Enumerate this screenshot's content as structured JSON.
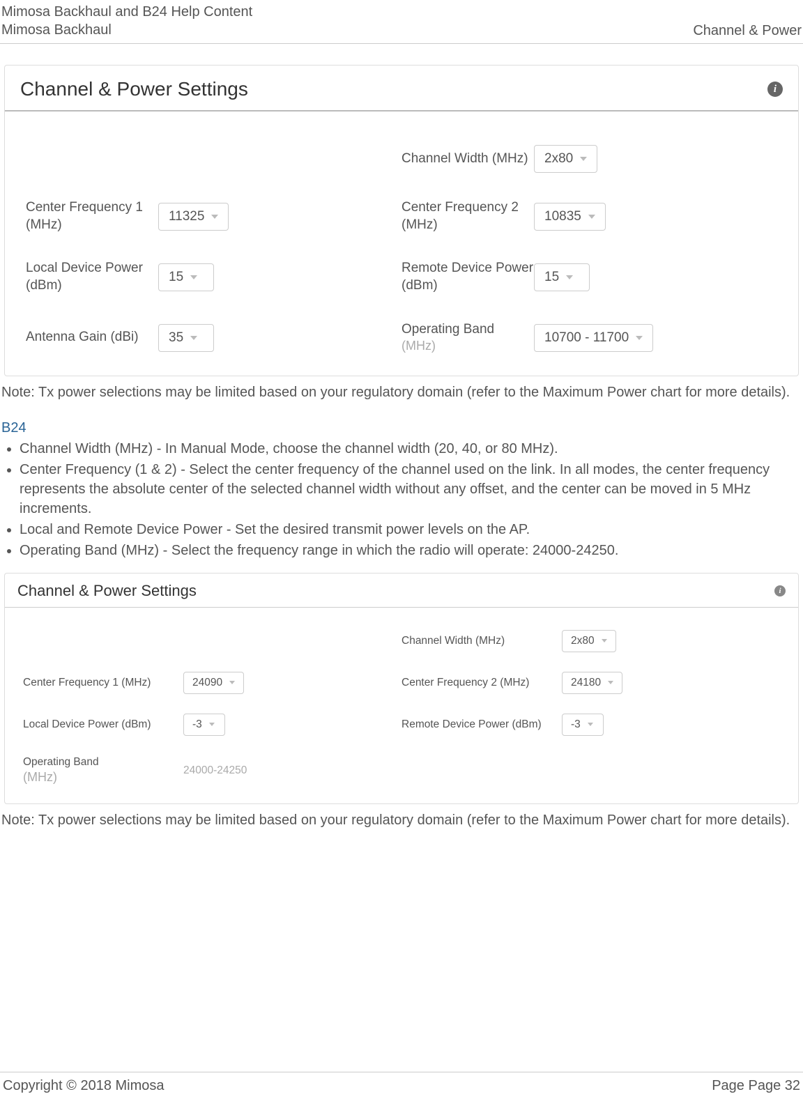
{
  "header": {
    "title_line1": "Mimosa Backhaul and B24 Help Content",
    "title_line2": "Mimosa Backhaul",
    "right": "Channel & Power"
  },
  "panel1": {
    "title": "Channel & Power Settings",
    "fields": {
      "channel_width_label": "Channel Width (MHz)",
      "channel_width_value": "2x80",
      "cf1_label": "Center Frequency 1 (MHz)",
      "cf1_value": "11325",
      "cf2_label": "Center Frequency 2 (MHz)",
      "cf2_value": "10835",
      "local_power_label": "Local Device Power (dBm)",
      "local_power_value": "15",
      "remote_power_label": "Remote Device Power (dBm)",
      "remote_power_value": "15",
      "antenna_gain_label": "Antenna Gain (dBi)",
      "antenna_gain_value": "35",
      "operating_band_label": "Operating Band",
      "operating_band_sublabel": "(MHz)",
      "operating_band_value": "10700 - 11700"
    }
  },
  "note1": "Note: Tx power selections may be limited based on your regulatory domain (refer to the Maximum Power chart for more details).",
  "section_b24": "B24",
  "bullets": [
    "Channel Width (MHz) - In Manual Mode, choose the channel width (20, 40, or 80 MHz).",
    "Center Frequency (1 & 2) - Select the center frequency of the channel used on the link. In all modes, the center frequency represents the absolute center of the selected channel width without any offset, and the center can be moved in 5 MHz increments.",
    "Local and Remote Device Power - Set the desired transmit power levels on the AP.",
    "Operating Band (MHz) - Select the frequency range in which the radio will operate: 24000-24250."
  ],
  "panel2": {
    "title": "Channel & Power Settings",
    "fields": {
      "channel_width_label": "Channel Width (MHz)",
      "channel_width_value": "2x80",
      "cf1_label": "Center Frequency 1 (MHz)",
      "cf1_value": "24090",
      "cf2_label": "Center Frequency 2 (MHz)",
      "cf2_value": "24180",
      "local_power_label": "Local Device Power (dBm)",
      "local_power_value": "-3",
      "remote_power_label": "Remote Device Power (dBm)",
      "remote_power_value": "-3",
      "operating_band_label": "Operating Band",
      "operating_band_sublabel": "(MHz)",
      "operating_band_value": "24000-24250"
    }
  },
  "note2": "Note: Tx power selections may be limited based on your regulatory domain (refer to the Maximum Power chart for more details).",
  "footer": {
    "left": "Copyright © 2018 Mimosa",
    "right": "Page Page 32"
  }
}
